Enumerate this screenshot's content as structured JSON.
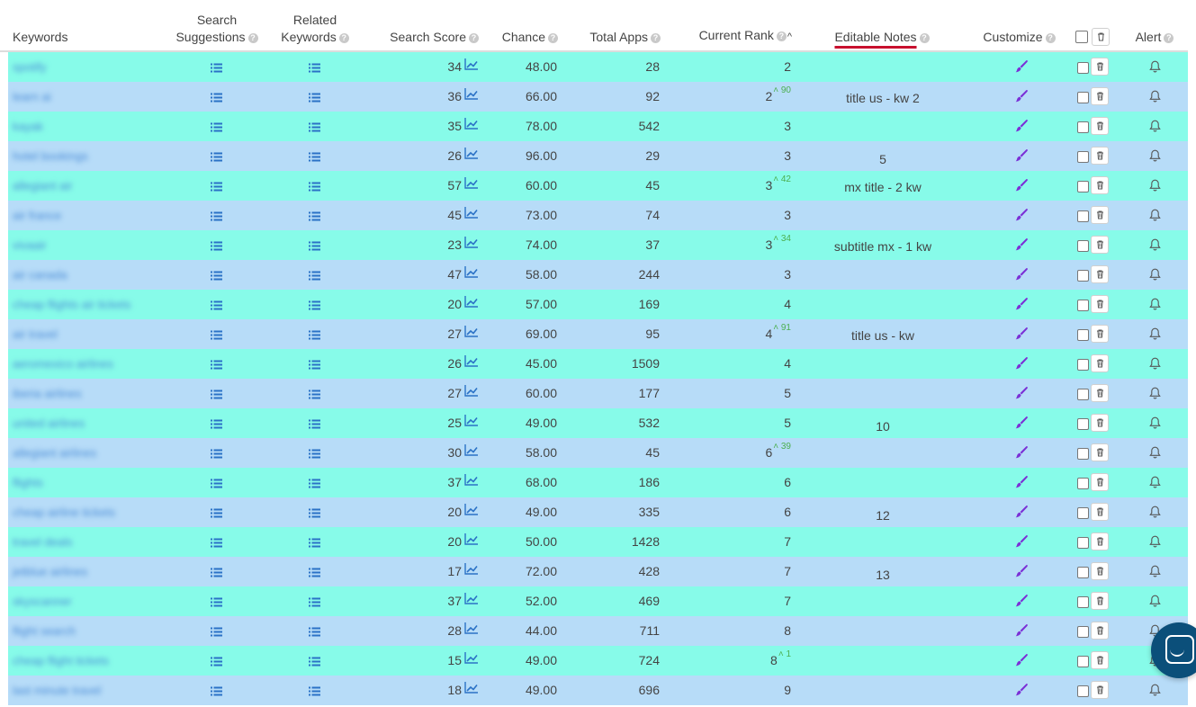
{
  "headers": {
    "keywords": "Keywords",
    "search_suggestions_1": "Search",
    "search_suggestions_2": "Suggestions",
    "related_keywords_1": "Related",
    "related_keywords_2": "Keywords",
    "search_score": "Search Score",
    "chance": "Chance",
    "total_apps": "Total Apps",
    "current_rank": "Current Rank",
    "editable_notes": "Editable Notes",
    "customize": "Customize",
    "alert": "Alert",
    "help_glyph": "?"
  },
  "colors": {
    "row_teal": "#87fbe9",
    "row_blue": "#b7dcf8",
    "icon_blue": "#2b72c6",
    "brush_purple": "#7b2fd6",
    "rank_change_green": "#4caf50",
    "notes_underline": "#c8102e",
    "chat_button": "#0b4f7a"
  },
  "icons": {
    "suggestions": "list-icon",
    "related": "list-icon",
    "score_trend": "trend-chart-icon",
    "customize": "paint-brush-icon",
    "delete": "trash-icon",
    "alert": "bell-icon",
    "help": "question-icon",
    "chat": "chat-icon"
  },
  "rows": [
    {
      "keyword": "spotify",
      "search_score": "34",
      "chance": "48.00",
      "total_apps": "28",
      "rank": "2",
      "rank_change": "",
      "note": ""
    },
    {
      "keyword": "learn ai",
      "search_score": "36",
      "chance": "66.00",
      "total_apps": "92",
      "rank": "2",
      "rank_change": "90",
      "note": "title us - kw 2"
    },
    {
      "keyword": "kayak",
      "search_score": "35",
      "chance": "78.00",
      "total_apps": "542",
      "rank": "3",
      "rank_change": "",
      "note": ""
    },
    {
      "keyword": "hotel bookings",
      "search_score": "26",
      "chance": "96.00",
      "total_apps": "29",
      "rank": "3",
      "rank_change": "",
      "note": "5"
    },
    {
      "keyword": "allegiant air",
      "search_score": "57",
      "chance": "60.00",
      "total_apps": "45",
      "rank": "3",
      "rank_change": "42",
      "note": "mx title - 2 kw"
    },
    {
      "keyword": "air france",
      "search_score": "45",
      "chance": "73.00",
      "total_apps": "74",
      "rank": "3",
      "rank_change": "",
      "note": ""
    },
    {
      "keyword": "vivaair",
      "search_score": "23",
      "chance": "74.00",
      "total_apps": "37",
      "rank": "3",
      "rank_change": "34",
      "note": "subtitle mx - 1 kw"
    },
    {
      "keyword": "air canada",
      "search_score": "47",
      "chance": "58.00",
      "total_apps": "244",
      "rank": "3",
      "rank_change": "",
      "note": ""
    },
    {
      "keyword": "cheap flights air tickets",
      "search_score": "20",
      "chance": "57.00",
      "total_apps": "169",
      "rank": "4",
      "rank_change": "",
      "note": ""
    },
    {
      "keyword": "air travel",
      "search_score": "27",
      "chance": "69.00",
      "total_apps": "95",
      "rank": "4",
      "rank_change": "91",
      "note": "title us - kw"
    },
    {
      "keyword": "aeromexico airlines",
      "search_score": "26",
      "chance": "45.00",
      "total_apps": "1509",
      "rank": "4",
      "rank_change": "",
      "note": ""
    },
    {
      "keyword": "iberia airlines",
      "search_score": "27",
      "chance": "60.00",
      "total_apps": "177",
      "rank": "5",
      "rank_change": "",
      "note": ""
    },
    {
      "keyword": "united airlines",
      "search_score": "25",
      "chance": "49.00",
      "total_apps": "532",
      "rank": "5",
      "rank_change": "",
      "note": "10"
    },
    {
      "keyword": "allegiant airlines",
      "search_score": "30",
      "chance": "58.00",
      "total_apps": "45",
      "rank": "6",
      "rank_change": "39",
      "note": ""
    },
    {
      "keyword": "flights",
      "search_score": "37",
      "chance": "68.00",
      "total_apps": "186",
      "rank": "6",
      "rank_change": "",
      "note": ""
    },
    {
      "keyword": "cheap airline tickets",
      "search_score": "20",
      "chance": "49.00",
      "total_apps": "335",
      "rank": "6",
      "rank_change": "",
      "note": "12"
    },
    {
      "keyword": "travel deals",
      "search_score": "20",
      "chance": "50.00",
      "total_apps": "1428",
      "rank": "7",
      "rank_change": "",
      "note": ""
    },
    {
      "keyword": "jetblue airlines",
      "search_score": "17",
      "chance": "72.00",
      "total_apps": "428",
      "rank": "7",
      "rank_change": "",
      "note": "13"
    },
    {
      "keyword": "skyscanner",
      "search_score": "37",
      "chance": "52.00",
      "total_apps": "469",
      "rank": "7",
      "rank_change": "",
      "note": ""
    },
    {
      "keyword": "flight search",
      "search_score": "28",
      "chance": "44.00",
      "total_apps": "711",
      "rank": "8",
      "rank_change": "",
      "note": ""
    },
    {
      "keyword": "cheap flight tickets",
      "search_score": "15",
      "chance": "49.00",
      "total_apps": "724",
      "rank": "8",
      "rank_change": "1",
      "note": ""
    },
    {
      "keyword": "last minute travel",
      "search_score": "18",
      "chance": "49.00",
      "total_apps": "696",
      "rank": "9",
      "rank_change": "",
      "note": ""
    }
  ]
}
